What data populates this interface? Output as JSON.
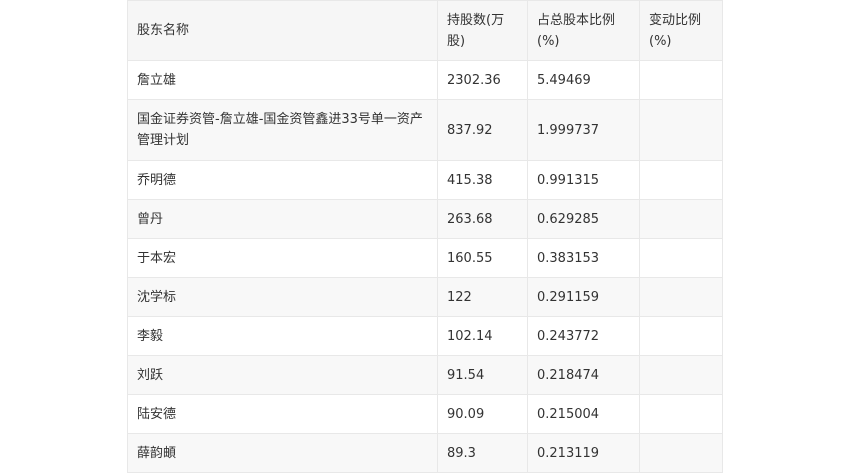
{
  "table": {
    "headers": [
      "股东名称",
      "持股数(万股)",
      "占总股本比例(%)",
      "变动比例(%)"
    ],
    "rows": [
      [
        "詹立雄",
        "2302.36",
        "5.49469",
        ""
      ],
      [
        "国金证券资管-詹立雄-国金资管鑫进33号单一资产管理计划",
        "837.92",
        "1.999737",
        ""
      ],
      [
        "乔明德",
        "415.38",
        "0.991315",
        ""
      ],
      [
        "曾丹",
        "263.68",
        "0.629285",
        ""
      ],
      [
        "于本宏",
        "160.55",
        "0.383153",
        ""
      ],
      [
        "沈学标",
        "122",
        "0.291159",
        ""
      ],
      [
        "李毅",
        "102.14",
        "0.243772",
        ""
      ],
      [
        "刘跃",
        "91.54",
        "0.218474",
        ""
      ],
      [
        "陆安德",
        "90.09",
        "0.215004",
        ""
      ],
      [
        "薛韵頔",
        "89.3",
        "0.213119",
        ""
      ]
    ]
  }
}
